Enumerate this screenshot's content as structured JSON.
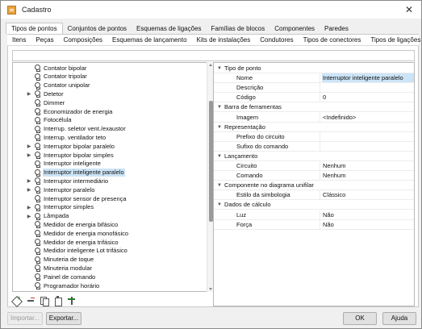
{
  "window": {
    "title": "Cadastro",
    "close_glyph": "✕"
  },
  "tabs_main": [
    "Tipos de pontos",
    "Conjuntos de pontos",
    "Esquemas de ligações",
    "Famílias de blocos",
    "Componentes",
    "Paredes"
  ],
  "tabs_sub": [
    "Itens",
    "Peças",
    "Composições",
    "Esquemas de lançamento",
    "Kits de instalações",
    "Condutores",
    "Tipos de conectores",
    "Tipos de ligações"
  ],
  "tree": {
    "items": [
      {
        "label": "Contator bipolar",
        "expandable": false
      },
      {
        "label": "Contator tripolar",
        "expandable": false
      },
      {
        "label": "Contator unipolar",
        "expandable": false
      },
      {
        "label": "Detetor",
        "expandable": true
      },
      {
        "label": "Dimmer",
        "expandable": false
      },
      {
        "label": "Economizador de energia",
        "expandable": false
      },
      {
        "label": "Fotocélula",
        "expandable": false
      },
      {
        "label": "Interrup. seletor vent./exaustor",
        "expandable": false
      },
      {
        "label": "Interrup. ventilador teto",
        "expandable": false
      },
      {
        "label": "Interruptor bipolar paralelo",
        "expandable": true
      },
      {
        "label": "Interruptor bipolar simples",
        "expandable": true
      },
      {
        "label": "Interruptor inteligente",
        "expandable": false
      },
      {
        "label": "Interruptor inteligente paralelo",
        "expandable": false,
        "selected": true
      },
      {
        "label": "Interruptor intermediário",
        "expandable": true
      },
      {
        "label": "Interruptor paralelo",
        "expandable": true
      },
      {
        "label": "Interruptor sensor de presença",
        "expandable": false
      },
      {
        "label": "Interruptor simples",
        "expandable": true
      },
      {
        "label": "Lâmpada",
        "expandable": true
      },
      {
        "label": "Medidor de energia bifásico",
        "expandable": false
      },
      {
        "label": "Medidor de energia monofásico",
        "expandable": false
      },
      {
        "label": "Medidor de energia trifásico",
        "expandable": false
      },
      {
        "label": "Medidor inteligente Lot trifásico",
        "expandable": false
      },
      {
        "label": "Minuteria de toque",
        "expandable": false
      },
      {
        "label": "Minuteria modular",
        "expandable": false
      },
      {
        "label": "Painel de comando",
        "expandable": false
      },
      {
        "label": "Programador horário",
        "expandable": false
      }
    ],
    "toolbar_icons": [
      "add-icon",
      "remove-icon",
      "copy-icon",
      "paste-icon",
      "tree-icon"
    ]
  },
  "properties": [
    {
      "type": "section",
      "name": "Tipo de ponto"
    },
    {
      "type": "prop",
      "name": "Nome",
      "value": "Interruptor inteligente paralelo",
      "highlight": true
    },
    {
      "type": "prop",
      "name": "Descrição",
      "value": ""
    },
    {
      "type": "prop",
      "name": "Código",
      "value": "0"
    },
    {
      "type": "section",
      "name": "Barra de ferramentas"
    },
    {
      "type": "prop",
      "name": "Imagem",
      "value": "<Indefinido>"
    },
    {
      "type": "section",
      "name": "Representação"
    },
    {
      "type": "prop",
      "name": "Prefixo do circuito",
      "value": ""
    },
    {
      "type": "prop",
      "name": "Sufixo do comando",
      "value": ""
    },
    {
      "type": "section",
      "name": "Lançamento"
    },
    {
      "type": "prop",
      "name": "Circuito",
      "value": "Nenhum"
    },
    {
      "type": "prop",
      "name": "Comando",
      "value": "Nenhum"
    },
    {
      "type": "section",
      "name": "Componente no diagrama unifilar"
    },
    {
      "type": "prop",
      "name": "Estilo da simbologia",
      "value": "Clássico"
    },
    {
      "type": "section",
      "name": "Dados de cálculo"
    },
    {
      "type": "prop",
      "name": "Luz",
      "value": "Não"
    },
    {
      "type": "prop",
      "name": "Força",
      "value": "Não"
    }
  ],
  "buttons": {
    "import": "Importar...",
    "export": "Exportar...",
    "ok": "OK",
    "help": "Ajuda"
  }
}
